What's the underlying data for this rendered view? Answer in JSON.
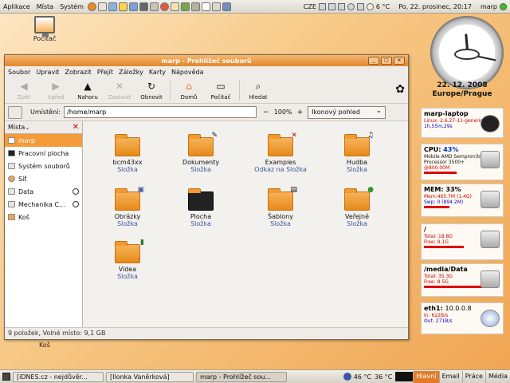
{
  "top_panel": {
    "menus": [
      "Aplikace",
      "Místa",
      "Systém"
    ],
    "keyboard": "CZE",
    "temperature": "6 °C",
    "datetime": "Po, 22. prosinec, 20:17",
    "user": "marp"
  },
  "desktop": {
    "computer_icon_label": "Počítač",
    "trash_icon_label": "Koš"
  },
  "clock_widget": {
    "date": "22. 12. 2008",
    "location": "Europe/Prague"
  },
  "sysmon": {
    "host": {
      "name": "marp-laptop",
      "kernel": "Linux: 2.6.27-11-generic",
      "uptime": "1h,55m,29s"
    },
    "cpu": {
      "label": "CPU:",
      "percent": "43%",
      "model": "Mobile AMD Sempron(tm)",
      "model2": "Processor 3500+",
      "freq": "@800.00M",
      "level": 0.43
    },
    "mem": {
      "label": "MEM:",
      "percent": "33%",
      "mem": "Mem:465.7M (1.4G)",
      "swap": "Swp: 0 (894.2M)",
      "level": 0.33
    },
    "root": {
      "label": "/",
      "total": "Total: 18.8G",
      "free": "Free: 9.1G",
      "level": 0.52
    },
    "data": {
      "label": "/media/Data",
      "total": "Total: 35.3G",
      "free": "Free: 8.5G",
      "level": 0.76
    },
    "net": {
      "label": "eth1:",
      "ip": "10.0.0.8",
      "in": "In:   622B/s",
      "out": "Out: 271B/s"
    }
  },
  "window": {
    "title": "marp - Prohlížeč souborů",
    "menu": [
      "Soubor",
      "Upravit",
      "Zobrazit",
      "Přejít",
      "Záložky",
      "Karty",
      "Nápověda"
    ],
    "toolbar": {
      "back": "Zpět",
      "forward": "Vpřed",
      "up": "Nahoru",
      "stop": "Zastavit",
      "reload": "Obnovit",
      "home": "Domů",
      "computer": "Počítač",
      "search": "Hledat"
    },
    "location_label": "Umístění:",
    "location_value": "/home/marp",
    "zoom": "100%",
    "view_mode": "Ikonový pohled",
    "sidebar_title": "Místa",
    "places": [
      "marp",
      "Pracovní plocha",
      "Systém souborů",
      "Síť",
      "Data",
      "Mechanika C...",
      "Koš"
    ],
    "files": [
      {
        "name": "bcm43xx",
        "type": "Složka"
      },
      {
        "name": "Dokumenty",
        "type": "Složka"
      },
      {
        "name": "Examples",
        "type": "Odkaz na Složka"
      },
      {
        "name": "Hudba",
        "type": "Složka"
      },
      {
        "name": "Obrázky",
        "type": "Složka"
      },
      {
        "name": "Plocha",
        "type": "Složka"
      },
      {
        "name": "Šablony",
        "type": "Složka"
      },
      {
        "name": "Veřejné",
        "type": "Složka"
      },
      {
        "name": "Videa",
        "type": "Složka"
      }
    ],
    "status": "9 položek, Volné místo: 9,1 GB"
  },
  "bottom_panel": {
    "tasks": [
      "[iDNES.cz - nejdůvěr...",
      "[Ilonka Vaněrková]",
      "marp - Prohlížeč sou..."
    ],
    "temp1": "46 °C",
    "temp2": "36 °C",
    "workspaces": [
      "Hlavní",
      "Email",
      "Práce",
      "Média"
    ]
  },
  "colors": {
    "accent": "#e37c2a",
    "selection": "#f49b3b",
    "link_text": "#3b56a3",
    "bar": "#e00000"
  }
}
